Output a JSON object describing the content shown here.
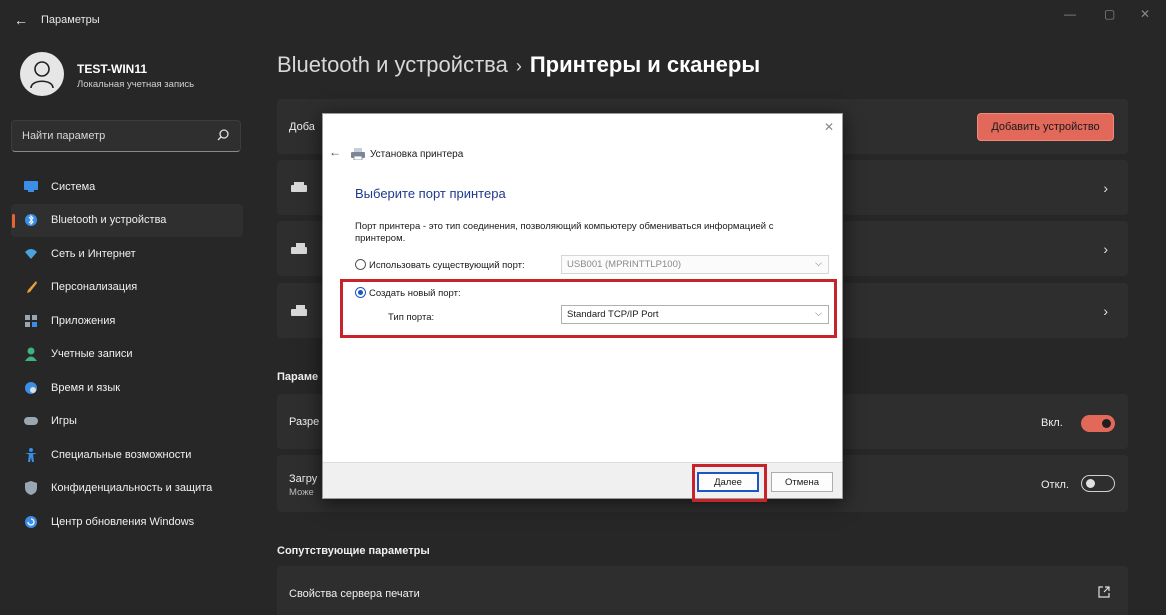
{
  "window": {
    "title": "Параметры",
    "back_glyph": "←",
    "controls": {
      "minimize": "—",
      "maximize": "▢",
      "close": "✕"
    }
  },
  "profile": {
    "name": "TEST-WIN11",
    "account_type": "Локальная учетная запись"
  },
  "search": {
    "placeholder": "Найти параметр",
    "icon": "search-icon"
  },
  "nav": {
    "items": [
      {
        "label": "Система",
        "icon": "monitor-icon",
        "color": "#3a8ee6"
      },
      {
        "label": "Bluetooth и устройства",
        "icon": "bluetooth-icon",
        "color": "#3a8ee6",
        "active": true
      },
      {
        "label": "Сеть и Интернет",
        "icon": "wifi-icon",
        "color": "#4aa3df"
      },
      {
        "label": "Персонализация",
        "icon": "brush-icon",
        "color": "#e8a23a"
      },
      {
        "label": "Приложения",
        "icon": "apps-icon",
        "color": "#9aa6b2"
      },
      {
        "label": "Учетные записи",
        "icon": "person-icon",
        "color": "#3fb27f"
      },
      {
        "label": "Время и язык",
        "icon": "globe-clock-icon",
        "color": "#3a8ee6"
      },
      {
        "label": "Игры",
        "icon": "gamepad-icon",
        "color": "#9aa6b2"
      },
      {
        "label": "Специальные возможности",
        "icon": "accessibility-icon",
        "color": "#3a8ee6"
      },
      {
        "label": "Конфиденциальность и защита",
        "icon": "shield-icon",
        "color": "#9aa6b2"
      },
      {
        "label": "Центр обновления Windows",
        "icon": "update-icon",
        "color": "#3a8ee6"
      }
    ]
  },
  "header": {
    "parent": "Bluetooth и устройства",
    "separator": "›",
    "current": "Принтеры и сканеры"
  },
  "main": {
    "add_row_label": "Доба",
    "add_device_button": "Добавить устройство",
    "printer_chevron": "›",
    "params_section": "Параме",
    "allow_row_label": "Разре",
    "allow_state": "Вкл.",
    "allow_on": true,
    "download_row_label": "Загру",
    "download_row_sub": "Може",
    "download_state": "Откл.",
    "download_on": false,
    "related_section": "Сопутствующие параметры",
    "print_server_label": "Свойства сервера печати",
    "external_link_icon": "external-link-icon"
  },
  "dialog": {
    "close_glyph": "✕",
    "back_glyph": "←",
    "title": "Установка принтера",
    "heading": "Выберите порт принтера",
    "description": "Порт принтера - это тип соединения, позволяющий компьютеру обмениваться информацией с принтером.",
    "option_existing": "Использовать существующий порт:",
    "existing_port_value": "USB001 (MPRINTTLP100)",
    "option_new": "Создать новый порт:",
    "new_selected": true,
    "port_type_label": "Тип порта:",
    "port_type_value": "Standard TCP/IP Port",
    "next_button": "Далее",
    "cancel_button": "Отмена"
  },
  "colors": {
    "accent": "#e2685a",
    "highlight_box": "#c6232b",
    "dialog_heading": "#1f3a8a"
  }
}
